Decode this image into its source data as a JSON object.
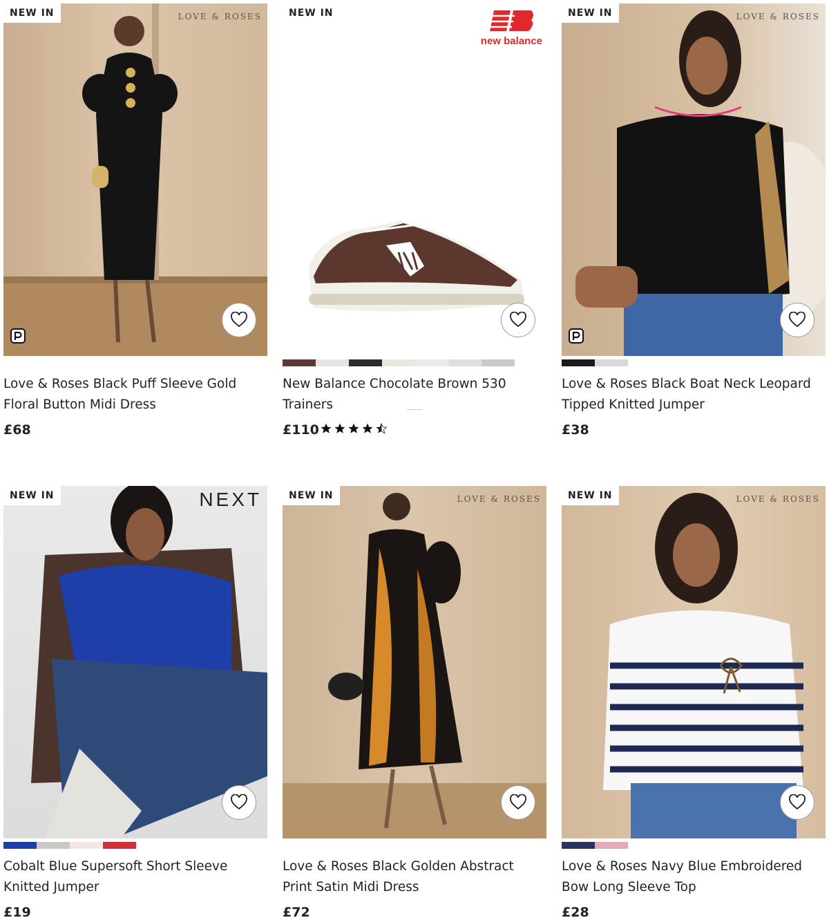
{
  "products": [
    {
      "badge": "NEW IN",
      "brand": "LOVE & ROSES",
      "name": "Love & Roses Black Puff Sleeve Gold Floral Button Midi Dress",
      "price": "£68",
      "swatches": []
    },
    {
      "badge": "NEW IN",
      "brand": "new balance",
      "name": "New Balance Chocolate Brown 530 Trainers",
      "price": "£110",
      "rating": 4.5,
      "swatches": [
        "#5a3a32",
        "#e4e4e0",
        "#2b2b2b",
        "#e8e6df",
        "#ecebe6",
        "#dde0e2",
        "#c9c9c5"
      ]
    },
    {
      "badge": "NEW IN",
      "brand": "LOVE & ROSES",
      "name": "Love & Roses Black Boat Neck Leopard Tipped Knitted Jumper",
      "price": "£38",
      "swatches": [
        "#1a1a1a",
        "#d9d9d9"
      ]
    },
    {
      "badge": "NEW IN",
      "brand": "NEXT",
      "name": "Cobalt Blue Supersoft Short Sleeve Knitted Jumper",
      "price": "£19",
      "swatches": [
        "#1f3fa8",
        "#c8c8c8",
        "#f4e6e0",
        "#cf2e3b"
      ]
    },
    {
      "badge": "NEW IN",
      "brand": "LOVE & ROSES",
      "name": "Love & Roses Black Golden Abstract Print Satin Midi Dress",
      "price": "£72",
      "swatches": []
    },
    {
      "badge": "NEW IN",
      "brand": "LOVE & ROSES",
      "name": "Love & Roses Navy Blue Embroidered Bow Long Sleeve Top",
      "price": "£28",
      "swatches": [
        "#2a3358",
        "#e3a9b6"
      ]
    }
  ]
}
